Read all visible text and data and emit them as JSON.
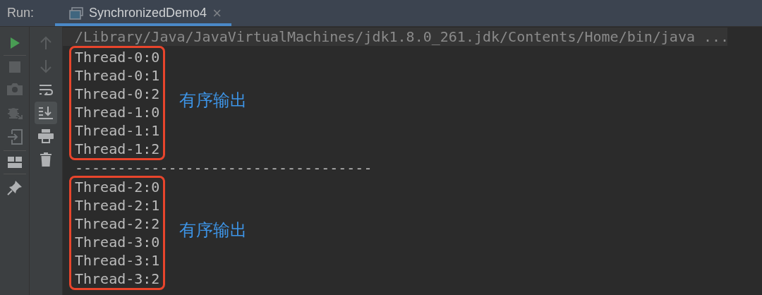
{
  "tool_window": {
    "title": "Run:",
    "tab": {
      "label": "SynchronizedDemo4",
      "selected": true,
      "close": "×"
    }
  },
  "toggles": {
    "soft_wrap": false,
    "scroll_to_end": true
  },
  "console": {
    "command": "/Library/Java/JavaVirtualMachines/jdk1.8.0_261.jdk/Contents/Home/bin/java ...",
    "groups": [
      {
        "lines": [
          "Thread-0:0",
          "Thread-0:1",
          "Thread-0:2",
          "Thread-1:0",
          "Thread-1:1",
          "Thread-1:2"
        ],
        "note": "有序输出"
      },
      {
        "lines": [
          "Thread-2:0",
          "Thread-2:1",
          "Thread-2:2",
          "Thread-3:0",
          "Thread-3:1",
          "Thread-3:2"
        ],
        "note": "有序输出"
      }
    ],
    "separator": "-----------------------------------"
  }
}
